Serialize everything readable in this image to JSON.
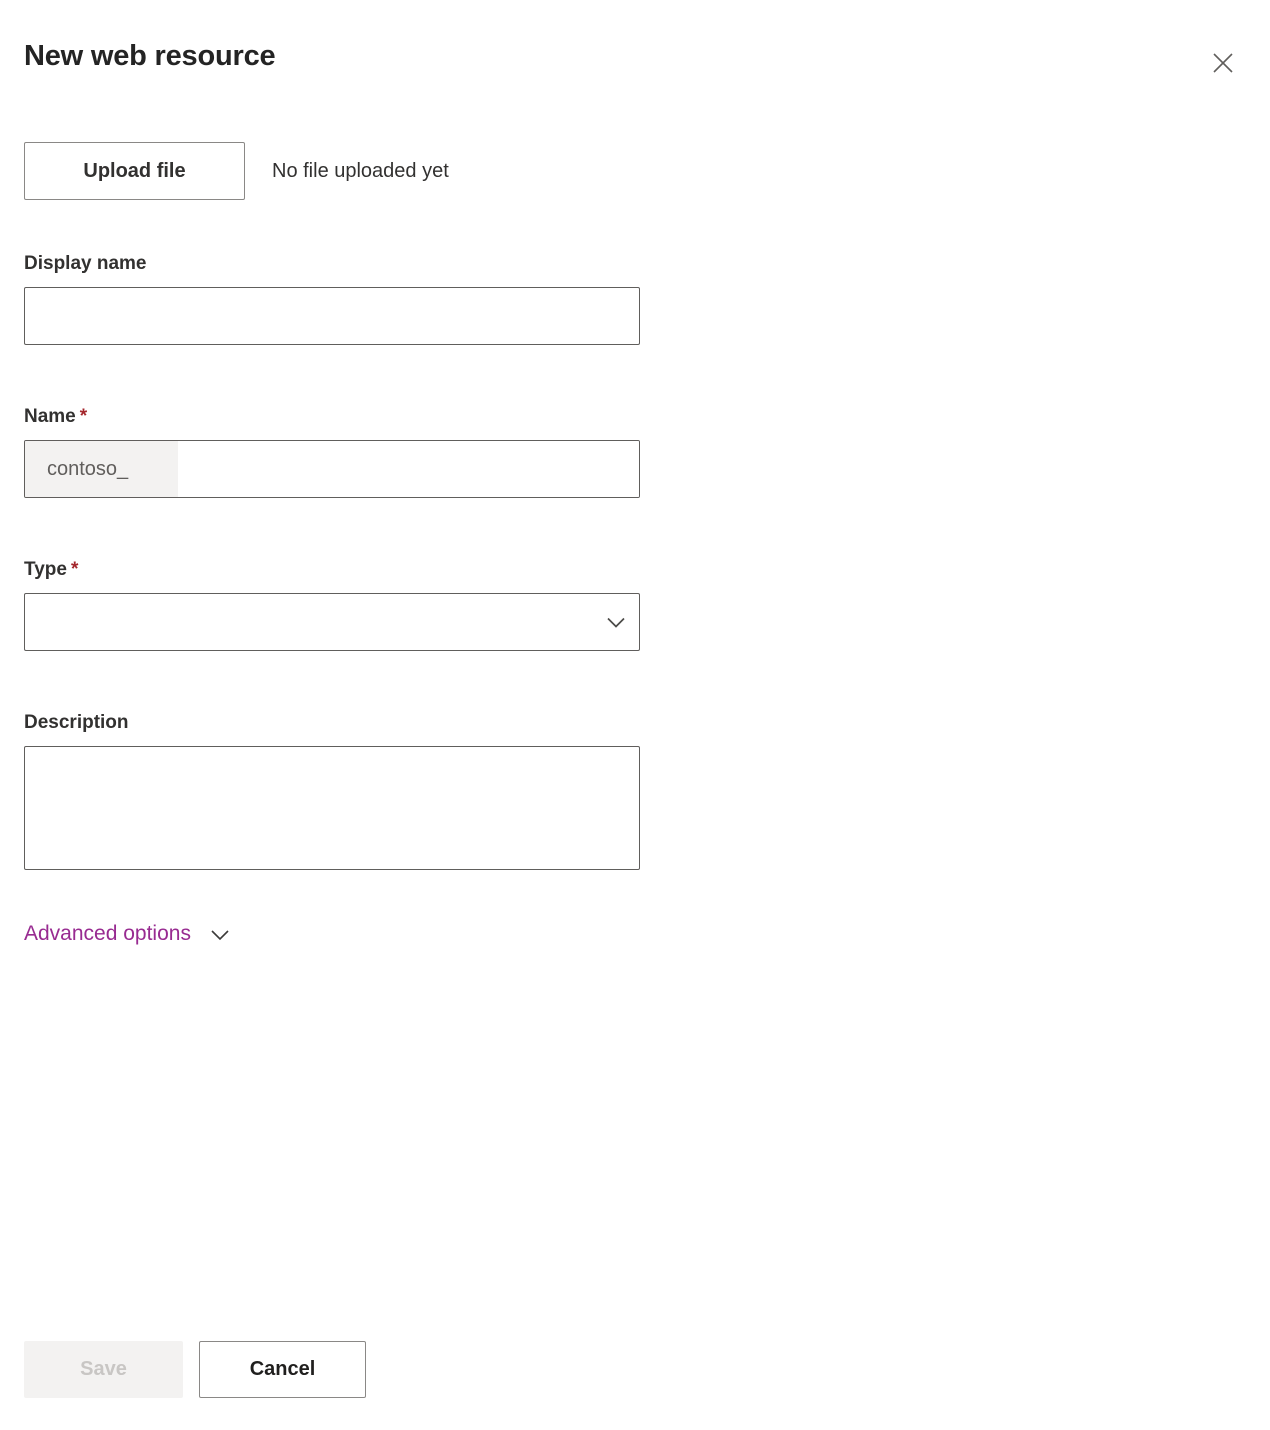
{
  "panel": {
    "title": "New web resource",
    "close_icon": "close-icon"
  },
  "upload": {
    "button_label": "Upload file",
    "status_text": "No file uploaded yet"
  },
  "fields": {
    "display_name": {
      "label": "Display name",
      "value": "",
      "placeholder": ""
    },
    "name": {
      "label": "Name",
      "required_marker": "*",
      "prefix": "contoso_",
      "value": "",
      "placeholder": ""
    },
    "type": {
      "label": "Type",
      "required_marker": "*",
      "value": "",
      "chevron_icon": "chevron-down-icon"
    },
    "description": {
      "label": "Description",
      "value": "",
      "placeholder": ""
    }
  },
  "advanced": {
    "label": "Advanced options",
    "chevron_icon": "chevron-down-icon"
  },
  "footer": {
    "save_label": "Save",
    "cancel_label": "Cancel"
  },
  "colors": {
    "accent_purple": "#982b91",
    "required_red": "#a4262c",
    "text_primary": "#323130",
    "border": "#605e5c",
    "disabled_bg": "#f3f2f1",
    "disabled_text": "#c8c6c4"
  }
}
